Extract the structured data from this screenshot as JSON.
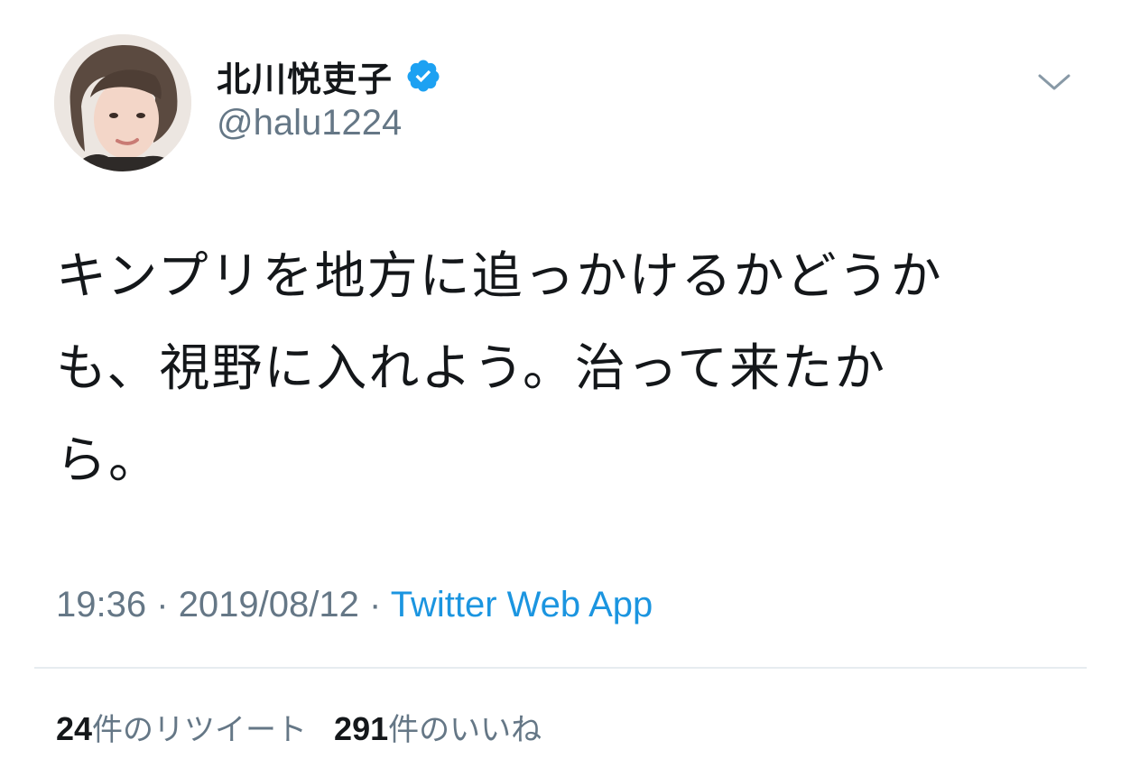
{
  "author": {
    "display_name": "北川悦吏子",
    "handle": "@halu1224",
    "verified": true,
    "avatar_icon": "profile-photo"
  },
  "icons": {
    "verified": "verified-badge-icon",
    "menu": "chevron-down-icon"
  },
  "tweet": {
    "text_lines": [
      "キンプリを地方に追っかけるかどうか",
      "も、視野に入れよう。治って来たか",
      "ら。"
    ]
  },
  "meta": {
    "time": "19:36",
    "separator": "·",
    "date": "2019/08/12",
    "source": "Twitter Web App"
  },
  "stats": {
    "retweets_count": "24",
    "retweets_label": "件のリツイート",
    "likes_count": "291",
    "likes_label": "件のいいね"
  },
  "colors": {
    "text_primary": "#14171a",
    "text_secondary": "#657786",
    "link": "#1b95e0",
    "verified": "#1da1f2",
    "divider": "#e6ecf0"
  }
}
